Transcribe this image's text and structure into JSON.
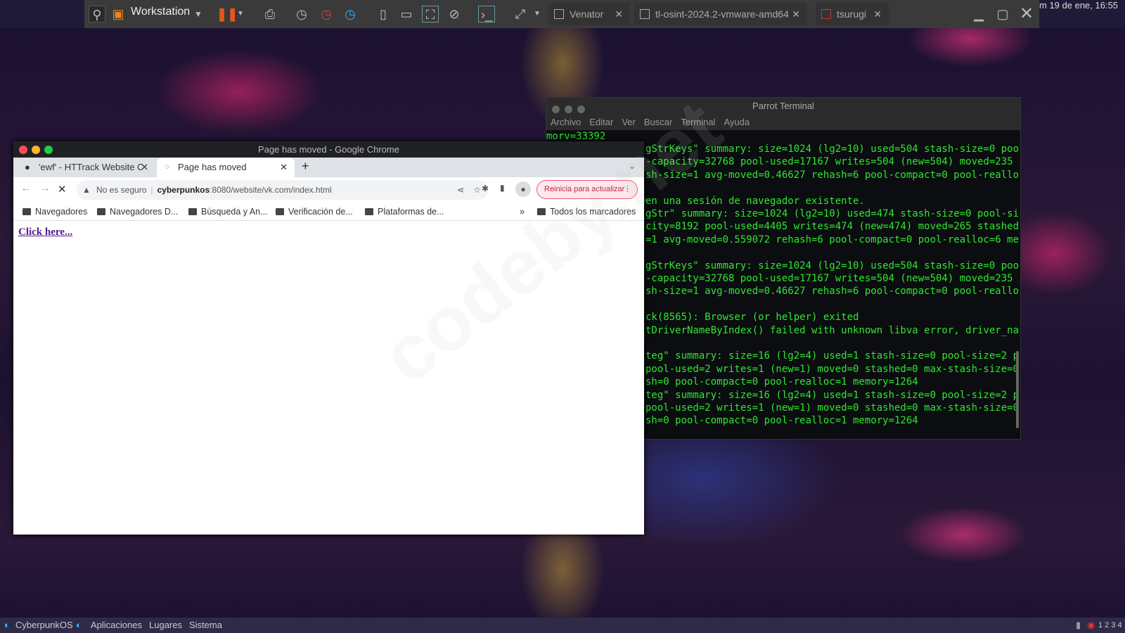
{
  "vmware": {
    "title": "Workstation",
    "tabs": [
      {
        "label": "Venator"
      },
      {
        "label": "tl-osint-2024.2-vmware-amd64"
      },
      {
        "label": "tsurugi"
      }
    ],
    "clock": "m 19 de ene, 16:55",
    "accent": "#e8541e"
  },
  "terminal": {
    "title": "Parrot Terminal",
    "menu": [
      "Archivo",
      "Editar",
      "Ver",
      "Buscar",
      "Terminal",
      "Ayuda"
    ],
    "first_line": "morv=33392",
    "lines": [
      "gStrKeys\" summary: size=1024 (lg2=10) used=504 stash-size=0 poo",
      "-capacity=32768 pool-used=17167 writes=504 (new=504) moved=235",
      "sh-size=1 avg-moved=0.46627 rehash=6 pool-compact=0 pool-reallo",
      "",
      "en una sesión de navegador existente.",
      "gStr\" summary: size=1024 (lg2=10) used=474 stash-size=0 pool-si",
      "city=8192 pool-used=4405 writes=474 (new=474) moved=265 stashed",
      "=1 avg-moved=0.559072 rehash=6 pool-compact=0 pool-realloc=6 me",
      "",
      "gStrKeys\" summary: size=1024 (lg2=10) used=504 stash-size=0 poo",
      "-capacity=32768 pool-used=17167 writes=504 (new=504) moved=235",
      "sh-size=1 avg-moved=0.46627 rehash=6 pool-compact=0 pool-reallo",
      "",
      "ck(8565): Browser (or helper) exited",
      "tDriverNameByIndex() failed with unknown libva error, driver_na",
      "",
      "teg\" summary: size=16 (lg2=4) used=1 stash-size=0 pool-size=2 p",
      "pool-used=2 writes=1 (new=1) moved=0 stashed=0 max-stash-size=0",
      "sh=0 pool-compact=0 pool-realloc=1 memory=1264",
      "teg\" summary: size=16 (lg2=4) used=1 stash-size=0 pool-size=2 p",
      "pool-used=2 writes=1 (new=1) moved=0 stashed=0 max-stash-size=0",
      "sh=0 pool-compact=0 pool-realloc=1 memory=1264"
    ],
    "text_color": "#2ee82e"
  },
  "chrome": {
    "title": "Page has moved - Google Chrome",
    "tabs": [
      {
        "label": "'ewf' - HTTrack Website C"
      },
      {
        "label": "Page has moved"
      }
    ],
    "security": "No es seguro",
    "url_host": "cyberpunkos",
    "url_rest": ":8080/website/vk.com/index.html",
    "update_button": "Reinicia para actualizar",
    "bookmarks": [
      "Navegadores",
      "Navegadores D...",
      "Búsqueda y An...",
      "Verificación de...",
      "Plataformas de..."
    ],
    "overflow": "»",
    "all_bookmarks": "Todos los marcadores",
    "page_link": "Click here..."
  },
  "watermark": "codeby.net",
  "taskbar": {
    "items": [
      "CyberpunkOS",
      "Aplicaciones",
      "Lugares",
      "Sistema"
    ],
    "workspaces": "1 2 3 4"
  }
}
